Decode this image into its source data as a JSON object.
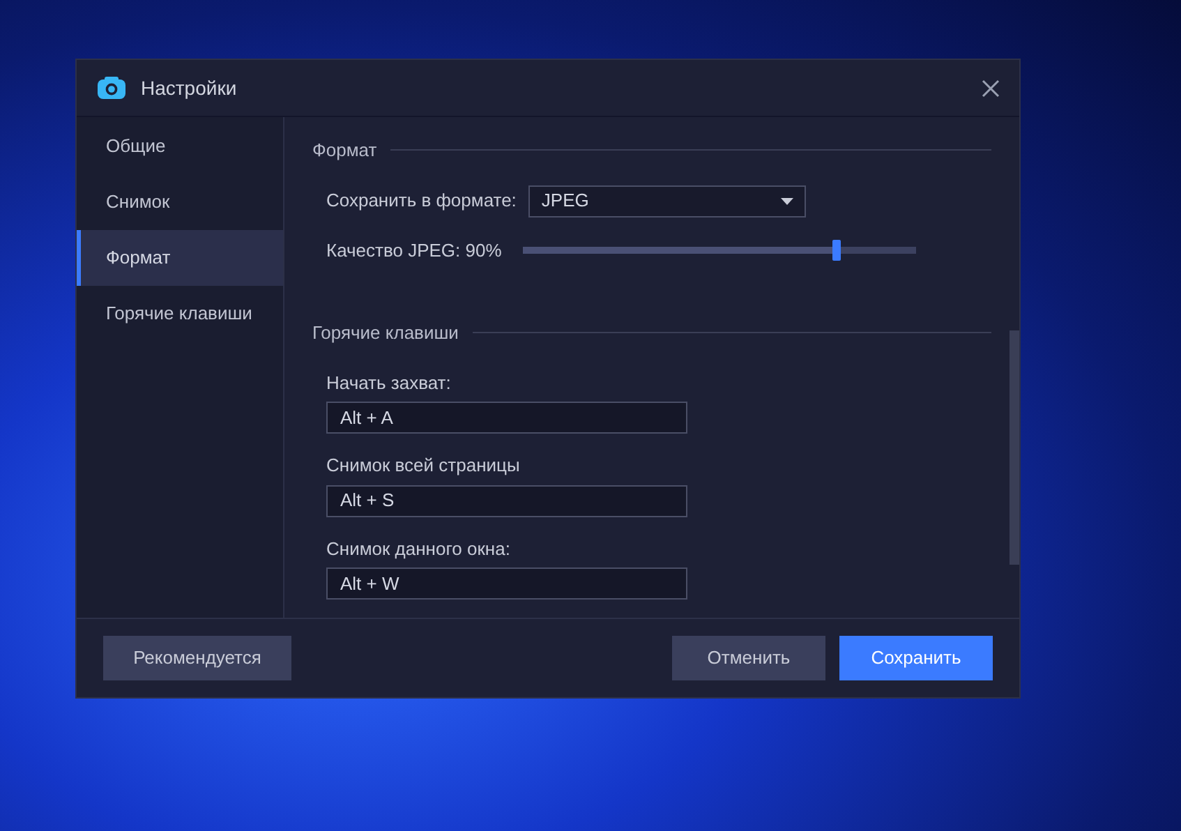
{
  "window": {
    "title": "Настройки"
  },
  "sidebar": {
    "items": [
      {
        "label": "Общие",
        "selected": false
      },
      {
        "label": "Снимок",
        "selected": false
      },
      {
        "label": "Формат",
        "selected": true
      },
      {
        "label": "Горячие клавиши",
        "selected": false
      }
    ]
  },
  "format_section": {
    "title": "Формат",
    "save_format_label": "Сохранить в формате:",
    "save_format_value": "JPEG",
    "quality_label": "Качество JPEG: 90%",
    "quality_slider": {
      "level": 0.8
    }
  },
  "hotkeys_section": {
    "title": "Горячие клавиши",
    "fields": [
      {
        "label": "Начать захват:",
        "value": "Alt + A"
      },
      {
        "label": "Снимок всей страницы",
        "value": "Alt + S"
      },
      {
        "label": "Снимок данного окна:",
        "value": "Alt + W"
      }
    ]
  },
  "buttons": {
    "recommended": "Рекомендуется",
    "cancel": "Отменить",
    "save": "Сохранить"
  }
}
